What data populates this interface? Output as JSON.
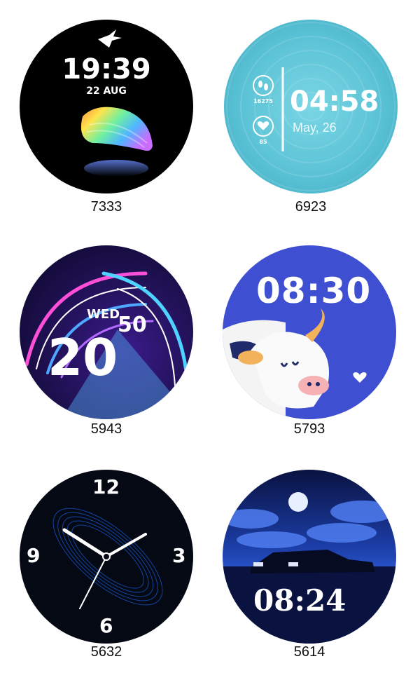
{
  "watchfaces": [
    {
      "id": "7333",
      "time": "19:39",
      "date": "22 AUG"
    },
    {
      "id": "6923",
      "time": "04:58",
      "date": "May, 26",
      "steps": "16275",
      "heart": "85"
    },
    {
      "id": "5943",
      "day": "WED",
      "minute": "50",
      "hour": "20"
    },
    {
      "id": "5793",
      "time": "08:30"
    },
    {
      "id": "5632",
      "numerals": [
        "12",
        "3",
        "6",
        "9"
      ]
    },
    {
      "id": "5614",
      "time": "08:24"
    }
  ],
  "colors": {
    "face1_bg": "#000000",
    "face2_bg": "#5cc3d6",
    "face3_bg": "#1b0f4a",
    "face4_bg": "#3f4fd1",
    "face5_bg": "#050914",
    "face6_bg": "#1a2d7a"
  },
  "icons": {
    "face1": "brand-logo-icon",
    "face2_steps": "footsteps-icon",
    "face2_heart": "heart-icon"
  }
}
